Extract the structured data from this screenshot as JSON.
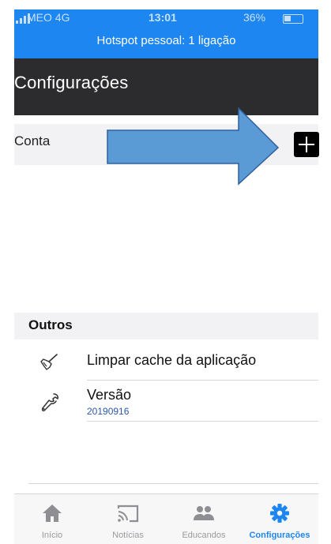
{
  "status_bar": {
    "carrier": "MEO  4G",
    "time": "13:01",
    "battery": "36%",
    "hotspot": "Hotspot pessoal: 1 ligação"
  },
  "header": {
    "title": "Configurações"
  },
  "account": {
    "label": "Conta",
    "add_icon": "plus-icon"
  },
  "annotation": {
    "arrow_color": "#5b9bd5",
    "arrow_outline": "#2f5f9e"
  },
  "others": {
    "section_title": "Outros",
    "items": [
      {
        "label": "Limpar cache da aplicação",
        "icon": "broom-icon"
      },
      {
        "label": "Versão",
        "sub": "20190916",
        "icon": "wrench-icon"
      }
    ]
  },
  "tabs": [
    {
      "label": "Início",
      "icon": "home-icon",
      "active": false
    },
    {
      "label": "Notícias",
      "icon": "cast-icon",
      "active": false
    },
    {
      "label": "Educandos",
      "icon": "people-icon",
      "active": false
    },
    {
      "label": "Configurações",
      "icon": "gear-icon",
      "active": true
    }
  ],
  "colors": {
    "accent": "#1e86f0",
    "header_bg": "#2c2c2e",
    "inactive_tab": "#9a9a9e"
  }
}
